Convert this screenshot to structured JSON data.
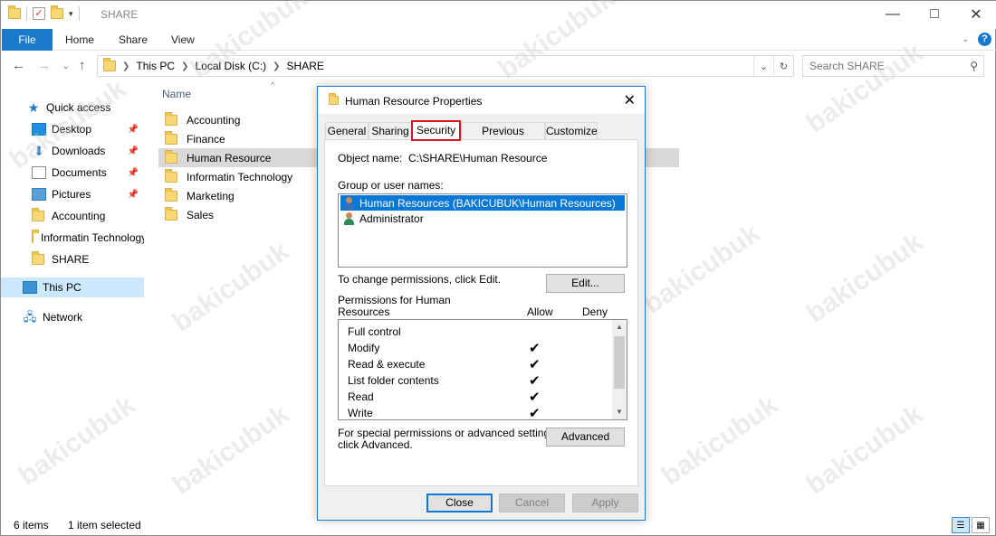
{
  "window": {
    "title": "SHARE"
  },
  "ribbon": {
    "tabs": [
      "File",
      "Home",
      "Share",
      "View"
    ]
  },
  "address": {
    "crumbs": [
      "This PC",
      "Local Disk (C:)",
      "SHARE"
    ]
  },
  "search": {
    "placeholder": "Search SHARE"
  },
  "sidebar": {
    "items": [
      {
        "label": "Quick access",
        "icon": "star-icon"
      },
      {
        "label": "Desktop",
        "icon": "desktop-icon",
        "pinned": true
      },
      {
        "label": "Downloads",
        "icon": "download-icon",
        "pinned": true
      },
      {
        "label": "Documents",
        "icon": "documents-icon",
        "pinned": true
      },
      {
        "label": "Pictures",
        "icon": "pictures-icon",
        "pinned": true
      },
      {
        "label": "Accounting",
        "icon": "folder-icon"
      },
      {
        "label": "Informatin Technology",
        "icon": "folder-icon"
      },
      {
        "label": "SHARE",
        "icon": "folder-icon"
      },
      {
        "label": "This PC",
        "icon": "computer-icon",
        "selected": true
      },
      {
        "label": "Network",
        "icon": "network-icon"
      }
    ]
  },
  "filelist": {
    "column_name": "Name",
    "files": [
      "Accounting",
      "Finance",
      "Human Resource",
      "Informatin Technology",
      "Marketing",
      "Sales"
    ],
    "selected": "Human Resource"
  },
  "status": {
    "count": "6 items",
    "selection": "1 item selected"
  },
  "dialog": {
    "title": "Human Resource Properties",
    "tabs": [
      "General",
      "Sharing",
      "Security",
      "Previous Versions",
      "Customize"
    ],
    "active_tab": "Security",
    "object_name_label": "Object name:",
    "object_name_value": "C:\\SHARE\\Human Resource",
    "group_label": "Group or user names:",
    "users": [
      "Human Resources (BAKICUBUK\\Human Resources)",
      "Administrator"
    ],
    "change_text": "To change permissions, click Edit.",
    "edit_button": "Edit...",
    "perm_label_line1": "Permissions for Human",
    "perm_label_line2": "Resources",
    "allow_header": "Allow",
    "deny_header": "Deny",
    "permissions": [
      {
        "name": "Full control",
        "allow": false,
        "deny": false
      },
      {
        "name": "Modify",
        "allow": true,
        "deny": false
      },
      {
        "name": "Read & execute",
        "allow": true,
        "deny": false
      },
      {
        "name": "List folder contents",
        "allow": true,
        "deny": false
      },
      {
        "name": "Read",
        "allow": true,
        "deny": false
      },
      {
        "name": "Write",
        "allow": true,
        "deny": false
      }
    ],
    "special_text_line1": "For special permissions or advanced settings,",
    "special_text_line2": "click Advanced.",
    "advanced_button": "Advanced",
    "close_button": "Close",
    "cancel_button": "Cancel",
    "apply_button": "Apply"
  },
  "watermark": "bakicubuk"
}
